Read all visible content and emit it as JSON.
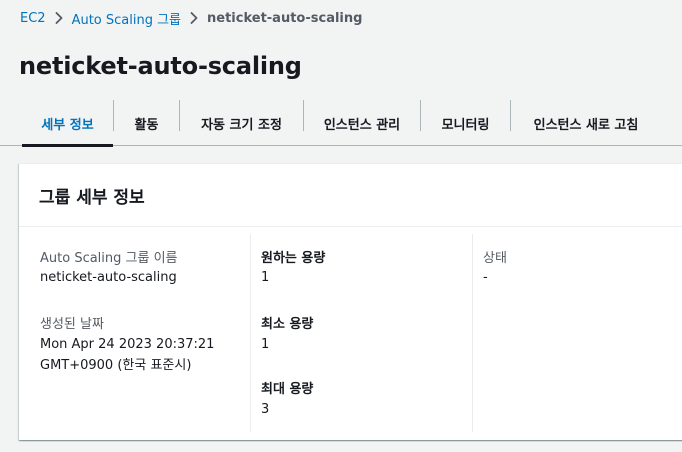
{
  "breadcrumb": {
    "items": [
      {
        "label": "EC2"
      },
      {
        "label": "Auto Scaling 그룹"
      },
      {
        "label": "neticket-auto-scaling"
      }
    ]
  },
  "page": {
    "title": "neticket-auto-scaling"
  },
  "tabs": [
    {
      "label": "세부 정보",
      "active": true
    },
    {
      "label": "활동"
    },
    {
      "label": "자동 크기 조정"
    },
    {
      "label": "인스턴스 관리"
    },
    {
      "label": "모니터링"
    },
    {
      "label": "인스턴스 새로 고침"
    }
  ],
  "group_details": {
    "title": "그룹 세부 정보",
    "name_label": "Auto Scaling 그룹 이름",
    "name_value": "neticket-auto-scaling",
    "created_label": "생성된 날짜",
    "created_value_line1": "Mon Apr 24 2023 20:37:21",
    "created_value_line2": "GMT+0900 (한국 표준시)",
    "desired_label": "원하는 용량",
    "desired_value": "1",
    "min_label": "최소 용량",
    "min_value": "1",
    "max_label": "최대 용량",
    "max_value": "3",
    "status_label": "상태",
    "status_value": "-"
  },
  "colors": {
    "link": "#0073bb",
    "text": "#16191f",
    "muted": "#545b64",
    "background": "#f2f3f3"
  }
}
